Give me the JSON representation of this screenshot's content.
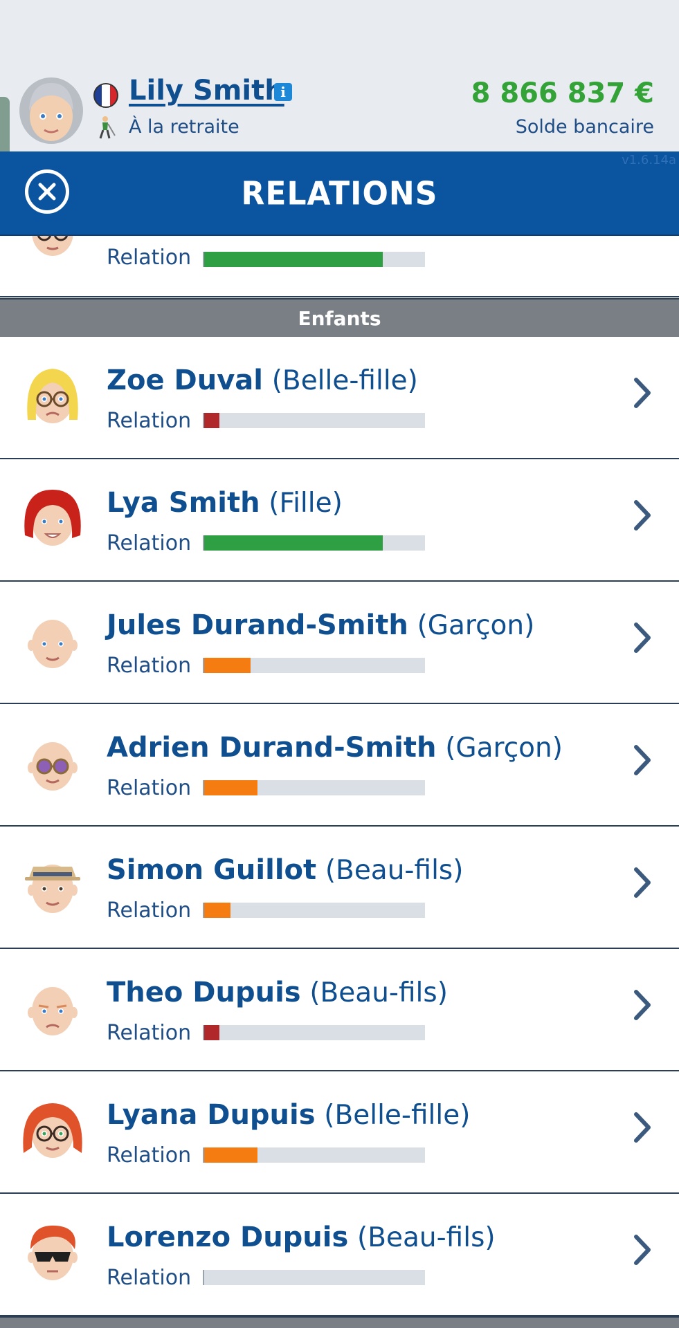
{
  "header": {
    "player_name": "Lily Smith",
    "status": "À la retraite",
    "balance_amount": "8 866 837 €",
    "balance_label": "Solde bancaire"
  },
  "titlebar": {
    "title": "RELATIONS",
    "version": "v1.6.14a"
  },
  "sections": {
    "children_header": "Enfants",
    "next_header": ""
  },
  "top_partial_row": {
    "relation_label": "Relation",
    "relation_level": 0.81,
    "bar_color": "#2ea043"
  },
  "rows": [
    {
      "name": "Zoe Duval",
      "role": "(Belle-fille)",
      "relation_label": "Relation",
      "relation_level": 0.07,
      "bar_color": "#b0282a",
      "avatar": "blonde-woman-glasses"
    },
    {
      "name": "Lya Smith",
      "role": "(Fille)",
      "relation_label": "Relation",
      "relation_level": 0.81,
      "bar_color": "#2ea043",
      "avatar": "redhead-woman"
    },
    {
      "name": "Jules Durand-Smith",
      "role": "(Garçon)",
      "relation_label": "Relation",
      "relation_level": 0.21,
      "bar_color": "#f57c10",
      "avatar": "bald-man"
    },
    {
      "name": "Adrien Durand-Smith",
      "role": "(Garçon)",
      "relation_label": "Relation",
      "relation_level": 0.24,
      "bar_color": "#f57c10",
      "avatar": "bald-man-purple-glasses"
    },
    {
      "name": "Simon Guillot",
      "role": "(Beau-fils)",
      "relation_label": "Relation",
      "relation_level": 0.12,
      "bar_color": "#f57c10",
      "avatar": "man-hat"
    },
    {
      "name": "Theo Dupuis",
      "role": "(Beau-fils)",
      "relation_label": "Relation",
      "relation_level": 0.07,
      "bar_color": "#b0282a",
      "avatar": "bald-man-frown"
    },
    {
      "name": "Lyana Dupuis",
      "role": "(Belle-fille)",
      "relation_label": "Relation",
      "relation_level": 0.24,
      "bar_color": "#f57c10",
      "avatar": "redhead-woman-glasses"
    },
    {
      "name": "Lorenzo Dupuis",
      "role": "(Beau-fils)",
      "relation_label": "Relation",
      "relation_level": 0.0,
      "bar_color": "#f57c10",
      "avatar": "redhead-man-sunglasses"
    }
  ]
}
